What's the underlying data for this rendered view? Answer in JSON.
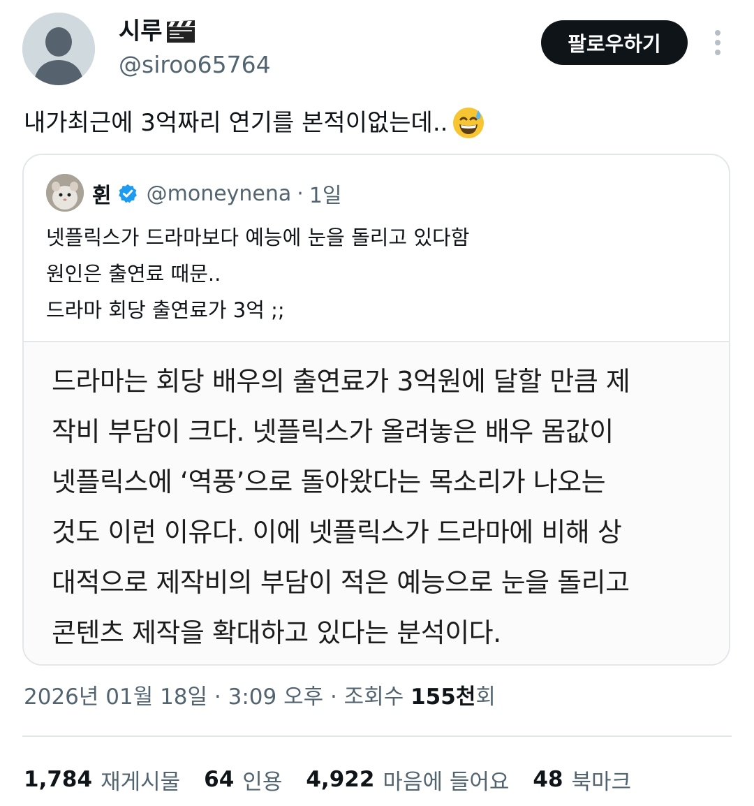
{
  "author": {
    "display_name": "시루",
    "display_name_emoji": "clapperboard-emoji",
    "handle": "@siroo65764"
  },
  "actions": {
    "follow_label": "팔로우하기",
    "more_icon": "more-vertical-icon"
  },
  "tweet": {
    "text": "내가최근에 3억짜리 연기를 본적이없는데..",
    "emoji": "sweat-smile-emoji"
  },
  "quoted": {
    "name": "휜",
    "verified_icon": "verified-badge-icon",
    "verified_color": "#1d9bf0",
    "handle": "@moneynena",
    "separator": "·",
    "time": "1일",
    "lines": [
      "넷플릭스가 드라마보다 예능에 눈을 돌리고 있다함",
      "원인은 출연료 때문..",
      "드라마 회당 출연료가 3억 ;;"
    ],
    "image_lines": [
      "드라마는 회당 배우의 출연료가 3억원에 달할 만큼 제",
      "작비 부담이 크다. 넷플릭스가 올려놓은 배우 몸값이",
      "넷플릭스에 ‘역풍’으로 돌아왔다는 목소리가 나오는",
      "것도 이런 이유다. 이에 넷플릭스가 드라마에 비해 상",
      "대적으로 제작비의 부담이 적은 예능으로 눈을 돌리고",
      "콘텐츠 제작을 확대하고 있다는 분석이다."
    ]
  },
  "meta": {
    "datetime": "2026년 01월 18일 · 3:09 오후 · 조회수 ",
    "views": "155천",
    "views_suffix": "회"
  },
  "stats": [
    {
      "num": "1,784",
      "label": "재게시물"
    },
    {
      "num": "64",
      "label": "인용"
    },
    {
      "num": "4,922",
      "label": "마음에 들어요"
    },
    {
      "num": "48",
      "label": "북마크"
    }
  ],
  "colors": {
    "text": "#0f1419",
    "secondary": "#536471",
    "border": "#e3e7ea",
    "button_bg": "#0f1419"
  }
}
